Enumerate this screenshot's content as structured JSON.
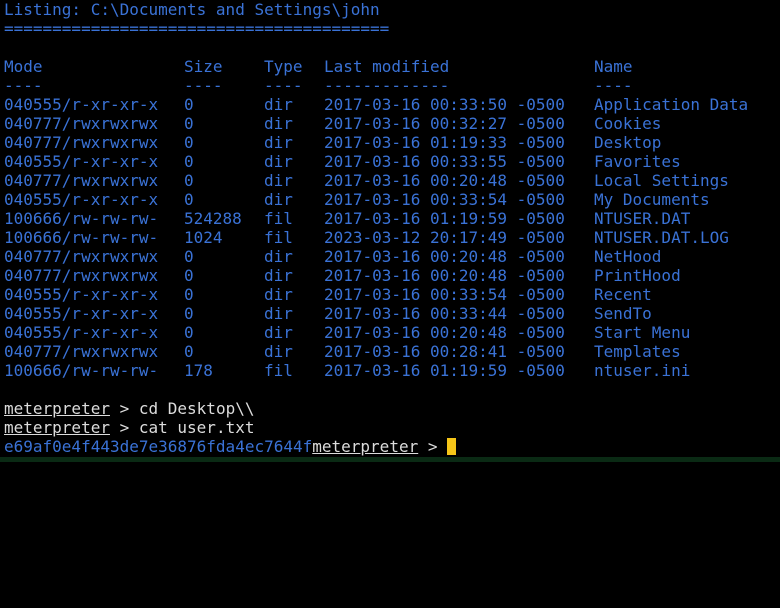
{
  "colors": {
    "background": "#000000",
    "listing_text": "#3a72d6",
    "prompt_text": "#dcdcdc",
    "cursor": "#f5c518"
  },
  "listing": {
    "title": "Listing: C:\\Documents and Settings\\john",
    "separator": "========================================",
    "headers": {
      "mode": "Mode",
      "size": "Size",
      "type": "Type",
      "modified": "Last modified",
      "name": "Name"
    },
    "underlines": {
      "mode": "----",
      "size": "----",
      "type": "----",
      "modified": "-------------",
      "name": "----"
    },
    "rows": [
      {
        "mode": "040555/r-xr-xr-x",
        "size": "0",
        "type": "dir",
        "modified": "2017-03-16 00:33:50 -0500",
        "name": "Application Data"
      },
      {
        "mode": "040777/rwxrwxrwx",
        "size": "0",
        "type": "dir",
        "modified": "2017-03-16 00:32:27 -0500",
        "name": "Cookies"
      },
      {
        "mode": "040777/rwxrwxrwx",
        "size": "0",
        "type": "dir",
        "modified": "2017-03-16 01:19:33 -0500",
        "name": "Desktop"
      },
      {
        "mode": "040555/r-xr-xr-x",
        "size": "0",
        "type": "dir",
        "modified": "2017-03-16 00:33:55 -0500",
        "name": "Favorites"
      },
      {
        "mode": "040777/rwxrwxrwx",
        "size": "0",
        "type": "dir",
        "modified": "2017-03-16 00:20:48 -0500",
        "name": "Local Settings"
      },
      {
        "mode": "040555/r-xr-xr-x",
        "size": "0",
        "type": "dir",
        "modified": "2017-03-16 00:33:54 -0500",
        "name": "My Documents"
      },
      {
        "mode": "100666/rw-rw-rw-",
        "size": "524288",
        "type": "fil",
        "modified": "2017-03-16 01:19:59 -0500",
        "name": "NTUSER.DAT"
      },
      {
        "mode": "100666/rw-rw-rw-",
        "size": "1024",
        "type": "fil",
        "modified": "2023-03-12 20:17:49 -0500",
        "name": "NTUSER.DAT.LOG"
      },
      {
        "mode": "040777/rwxrwxrwx",
        "size": "0",
        "type": "dir",
        "modified": "2017-03-16 00:20:48 -0500",
        "name": "NetHood"
      },
      {
        "mode": "040777/rwxrwxrwx",
        "size": "0",
        "type": "dir",
        "modified": "2017-03-16 00:20:48 -0500",
        "name": "PrintHood"
      },
      {
        "mode": "040555/r-xr-xr-x",
        "size": "0",
        "type": "dir",
        "modified": "2017-03-16 00:33:54 -0500",
        "name": "Recent"
      },
      {
        "mode": "040555/r-xr-xr-x",
        "size": "0",
        "type": "dir",
        "modified": "2017-03-16 00:33:44 -0500",
        "name": "SendTo"
      },
      {
        "mode": "040555/r-xr-xr-x",
        "size": "0",
        "type": "dir",
        "modified": "2017-03-16 00:20:48 -0500",
        "name": "Start Menu"
      },
      {
        "mode": "040777/rwxrwxrwx",
        "size": "0",
        "type": "dir",
        "modified": "2017-03-16 00:28:41 -0500",
        "name": "Templates"
      },
      {
        "mode": "100666/rw-rw-rw-",
        "size": "178",
        "type": "fil",
        "modified": "2017-03-16 01:19:59 -0500",
        "name": "ntuser.ini"
      }
    ]
  },
  "session": {
    "prompt_name": "meterpreter",
    "prompt_suffix": " > ",
    "commands": [
      "cd Desktop\\\\",
      "cat user.txt"
    ],
    "output": "e69af0e4f443de7e36876fda4ec7644f"
  }
}
